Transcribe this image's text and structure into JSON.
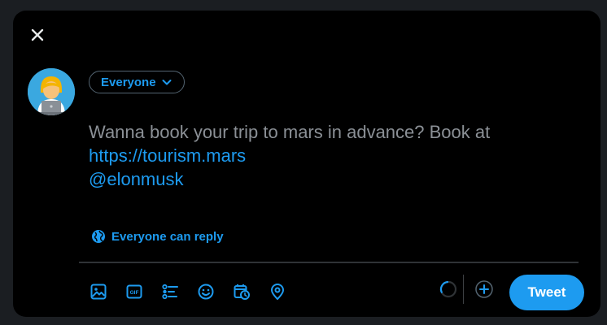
{
  "composer": {
    "audience_label": "Everyone",
    "text_plain": "Wanna book your trip to mars in advance? Book at",
    "text_link": "https://tourism.mars",
    "text_mention": "@elonmusk",
    "reply_setting_label": "Everyone can reply",
    "submit_label": "Tweet"
  },
  "toolbar": {
    "icons": [
      "media-icon",
      "gif-icon",
      "poll-icon",
      "emoji-icon",
      "schedule-icon",
      "location-icon"
    ]
  },
  "colors": {
    "accent": "#1d9bf0",
    "background": "#000000",
    "text_muted": "#8b9096",
    "border": "#536471"
  }
}
